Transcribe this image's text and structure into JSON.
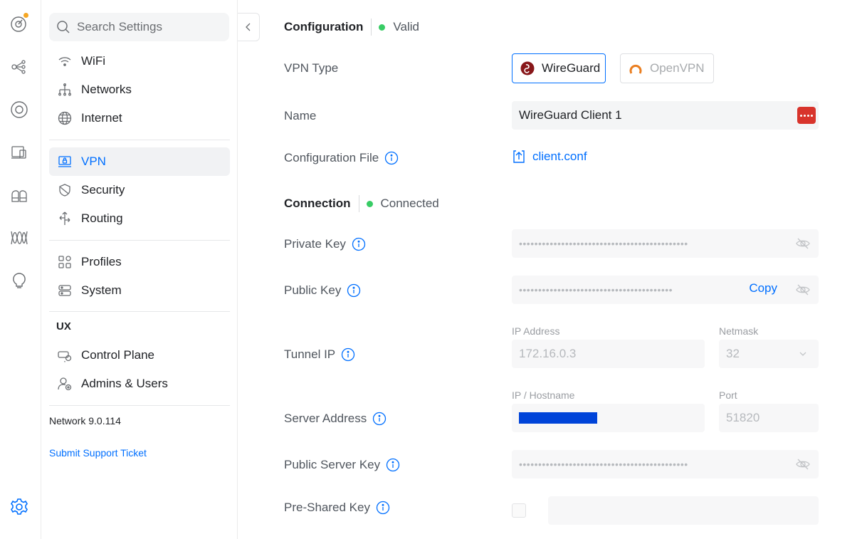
{
  "rail": {
    "icons": [
      "unifi-dashboard-icon",
      "topology-icon",
      "devices-icon",
      "clients-icon",
      "insights-icon",
      "traffic-icon",
      "ideas-icon",
      "settings-icon"
    ],
    "notification_color": "#f5a623"
  },
  "sidebar": {
    "search_placeholder": "Search Settings",
    "items": [
      {
        "label": "WiFi",
        "icon": "wifi-icon"
      },
      {
        "label": "Networks",
        "icon": "networks-icon"
      },
      {
        "label": "Internet",
        "icon": "globe-icon"
      },
      {
        "label": "VPN",
        "icon": "vpn-icon"
      },
      {
        "label": "Security",
        "icon": "shield-icon"
      },
      {
        "label": "Routing",
        "icon": "routing-icon"
      },
      {
        "label": "Profiles",
        "icon": "profiles-icon"
      },
      {
        "label": "System",
        "icon": "system-icon"
      },
      {
        "label": "Control Plane",
        "icon": "control-plane-icon"
      },
      {
        "label": "Admins & Users",
        "icon": "admins-icon"
      }
    ],
    "active": "VPN",
    "ux_section_label": "UX",
    "version": "Network 9.0.114",
    "support_link": "Submit Support Ticket"
  },
  "main": {
    "configuration": {
      "title": "Configuration",
      "status": "Valid"
    },
    "vpn_type": {
      "label": "VPN Type",
      "options": [
        "WireGuard",
        "OpenVPN"
      ],
      "selected": "WireGuard"
    },
    "name": {
      "label": "Name",
      "value": "WireGuard Client 1"
    },
    "config_file": {
      "label": "Configuration File",
      "file": "client.conf"
    },
    "connection": {
      "title": "Connection",
      "status": "Connected"
    },
    "private_key": {
      "label": "Private Key",
      "mask": "••••••••••••••••••••••••••••••••••••••••••••"
    },
    "public_key": {
      "label": "Public Key",
      "mask": "••••••••••••••••••••••••••••••••••••••••",
      "copy_label": "Copy"
    },
    "tunnel_ip": {
      "label": "Tunnel IP",
      "ip_label": "IP Address",
      "ip_value": "172.16.0.3",
      "netmask_label": "Netmask",
      "netmask_value": "32"
    },
    "server_address": {
      "label": "Server Address",
      "host_label": "IP / Hostname",
      "port_label": "Port",
      "port_value": "51820"
    },
    "public_server_key": {
      "label": "Public Server Key",
      "mask": "••••••••••••••••••••••••••••••••••••••••••••"
    },
    "pre_shared_key": {
      "label": "Pre-Shared Key"
    }
  },
  "colors": {
    "accent": "#006fff",
    "status_ok": "#38cc65",
    "wireguard": "#88171a",
    "openvpn": "#ea7e20"
  }
}
